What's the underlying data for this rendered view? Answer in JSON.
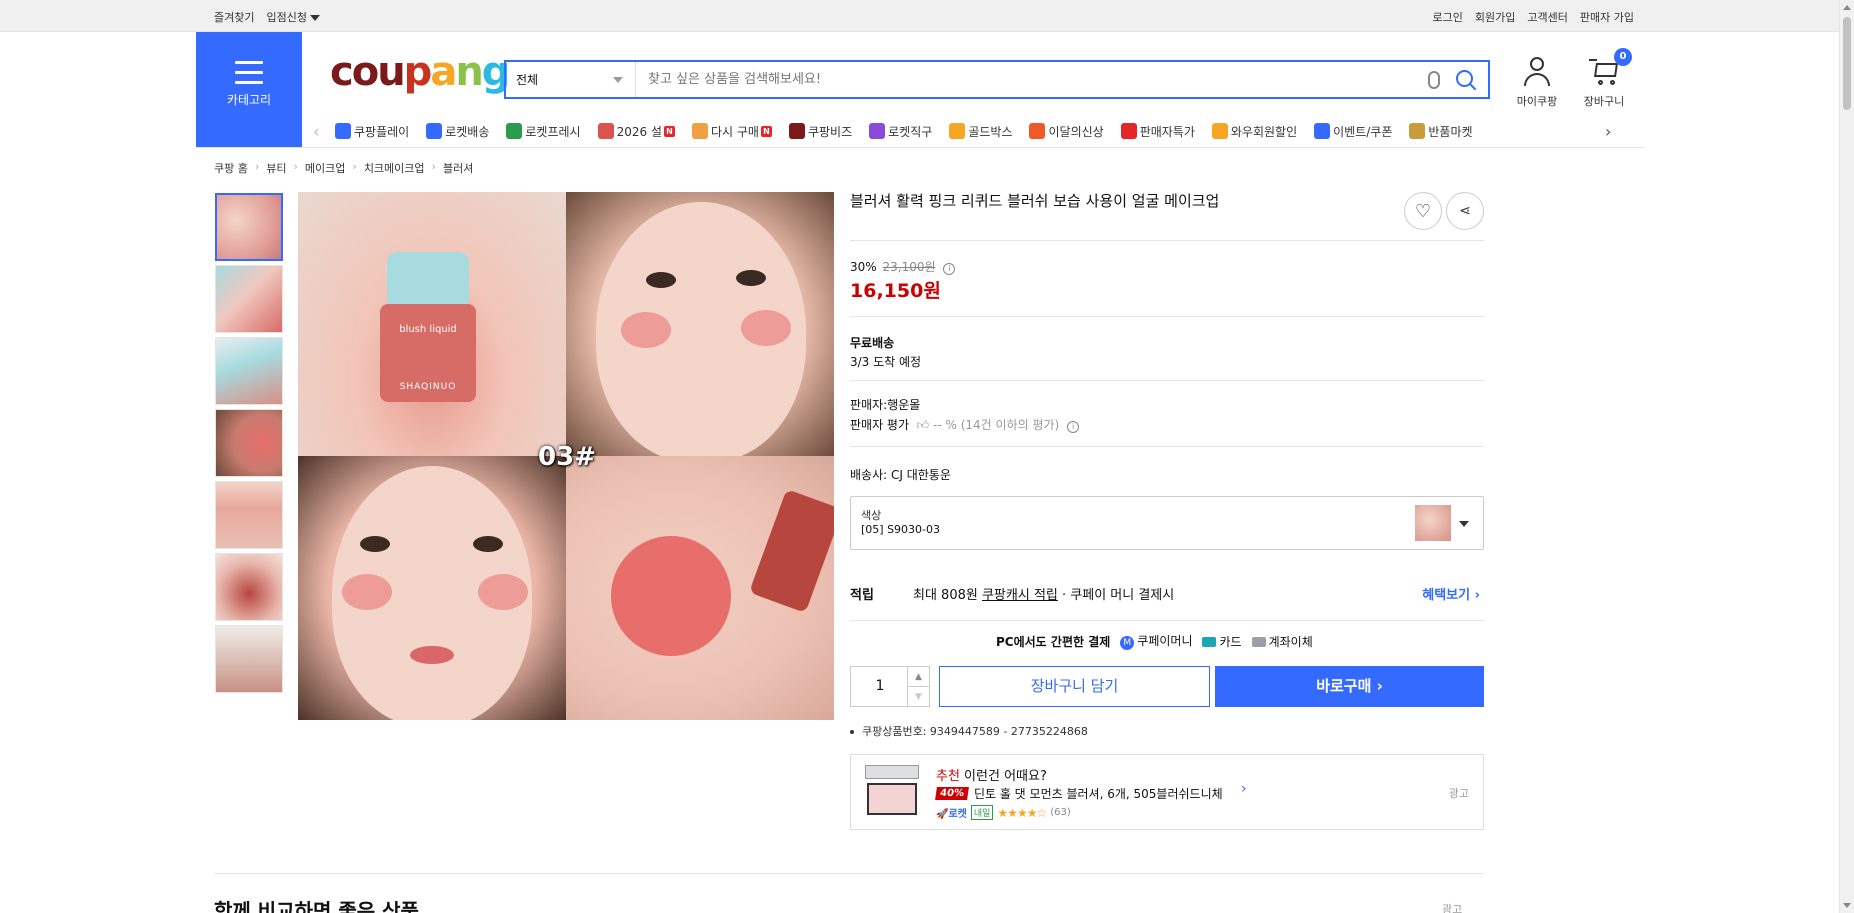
{
  "topbar": {
    "left": [
      "즐겨찾기",
      "입점신청"
    ],
    "right": [
      "로그인",
      "회원가입",
      "고객센터",
      "판매자 가입"
    ]
  },
  "header": {
    "category_label": "카테고리",
    "logo": [
      "cou",
      "p",
      "a",
      "n",
      "g"
    ],
    "search_category": "전체",
    "search_placeholder": "찾고 싶은 상품을 검색해보세요!",
    "mycoupang_label": "마이쿠팡",
    "cart_label": "장바구니",
    "cart_count": "0"
  },
  "catnav": {
    "items": [
      {
        "label": "쿠팡플레이",
        "color": "#346aff",
        "badge": ""
      },
      {
        "label": "로켓배송",
        "color": "#346aff",
        "badge": ""
      },
      {
        "label": "로켓프레시",
        "color": "#2b9c4d",
        "badge": ""
      },
      {
        "label": "2026 설",
        "color": "#d9534f",
        "badge": "N"
      },
      {
        "label": "다시 구매",
        "color": "#f0a040",
        "badge": "N"
      },
      {
        "label": "쿠팡비즈",
        "color": "#7a1a1a",
        "badge": ""
      },
      {
        "label": "로켓직구",
        "color": "#8a4bd8",
        "badge": ""
      },
      {
        "label": "골드박스",
        "color": "#f5a623",
        "badge": ""
      },
      {
        "label": "이달의신상",
        "color": "#f05a28",
        "badge": ""
      },
      {
        "label": "판매자특가",
        "color": "#e52528",
        "badge": ""
      },
      {
        "label": "와우회원할인",
        "color": "#f5a623",
        "badge": ""
      },
      {
        "label": "이벤트/쿠폰",
        "color": "#346aff",
        "badge": ""
      },
      {
        "label": "반품마켓",
        "color": "#c89b3c",
        "badge": ""
      }
    ]
  },
  "breadcrumb": [
    "쿠팡 홈",
    "뷰티",
    "메이크업",
    "치크메이크업",
    "블러셔"
  ],
  "product": {
    "title": "블러셔 활력 핑크 리퀴드 블러쉬 보습 사용이 얼굴 메이크업",
    "discount": "30%",
    "original_price": "23,100원",
    "price": "16,150원",
    "shipping_title": "무료배송",
    "shipping_eta": "3/3 도착 예정",
    "seller": "판매자:행운몰",
    "seller_rating_label": "판매자 평가",
    "seller_rating_value": "-- % (14건 이하의 평가)",
    "carrier": "배송사:  CJ 대한통운",
    "option_label": "색상",
    "option_value": "[05] S9030-03",
    "reward_label": "적립",
    "reward_text_1": "최대 808원 ",
    "reward_text_link": "쿠팡캐시 적립",
    "reward_text_2": " · 쿠페이 머니 결제시",
    "reward_more": "혜택보기 ›",
    "pay_title": "PC에서도 간편한 결제",
    "pay_methods": [
      "쿠페이머니",
      "카드",
      "계좌이체"
    ],
    "quantity": "1",
    "add_to_cart": "장바구니 담기",
    "buy_now": "바로구매 ›",
    "product_id": "쿠팡상품번호: 9349447589 - 27735224868",
    "image_code": "03#",
    "bottle_label": "blush liquid",
    "bottle_brand": "SHAQINUO"
  },
  "recommendation": {
    "label_red": "추천",
    "label": " 이런건 어때요?",
    "discount": "40%",
    "name": "딘토 홀 댓 모먼츠 블러셔, 6개, 505블러쉬드니체",
    "rocket": "🚀로켓",
    "tomorrow": "내일",
    "stars": "★★★★☆",
    "reviews": "(63)",
    "ad": "광고"
  },
  "section": {
    "title": "함께 비교하면 좋은 상품",
    "ad": "광고"
  }
}
